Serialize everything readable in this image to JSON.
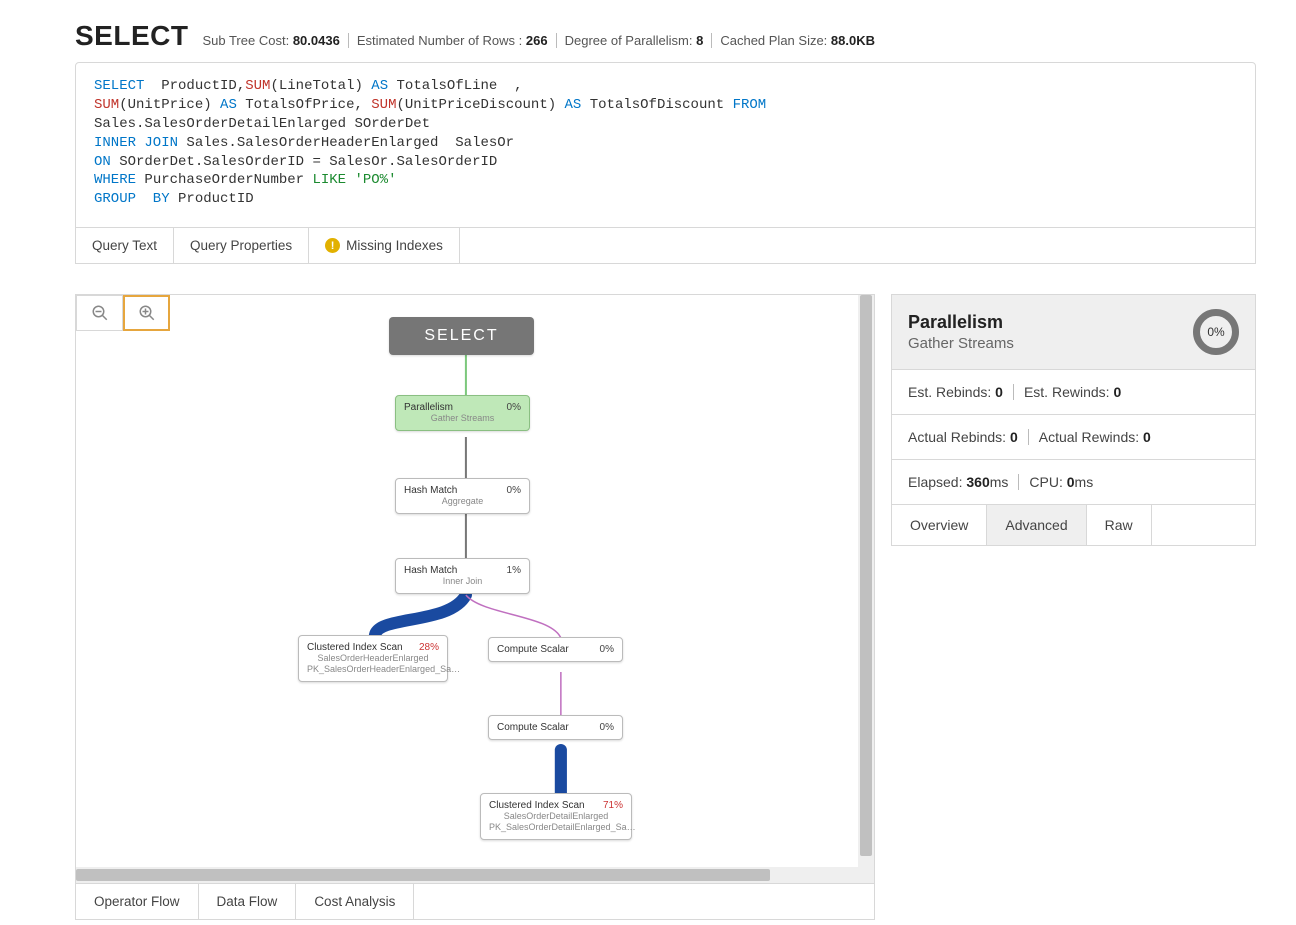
{
  "header": {
    "title": "SELECT",
    "meta": [
      {
        "label": "Sub Tree Cost:",
        "value": "80.0436"
      },
      {
        "label": "Estimated Number of Rows :",
        "value": "266"
      },
      {
        "label": "Degree of Parallelism:",
        "value": "8"
      },
      {
        "label": "Cached Plan Size:",
        "value": "88.0KB"
      }
    ]
  },
  "query_tabs": {
    "text": "Query Text",
    "properties": "Query Properties",
    "missing": "Missing Indexes"
  },
  "sql": {
    "l1": {
      "a": "SELECT",
      "b": "  ProductID,",
      "c": "SUM",
      "d": "(LineTotal) ",
      "e": "AS",
      "f": " TotalsOfLine  ,"
    },
    "l2": {
      "a": "SUM",
      "b": "(UnitPrice) ",
      "c": "AS",
      "d": " TotalsOfPrice, ",
      "e": "SUM",
      "f": "(UnitPriceDiscount) ",
      "g": "AS",
      "h": " TotalsOfDiscount ",
      "i": "FROM"
    },
    "l3": {
      "a": "Sales.SalesOrderDetailEnlarged SOrderDet"
    },
    "l4": {
      "a": "INNER JOIN",
      "b": " Sales.SalesOrderHeaderEnlarged  SalesOr"
    },
    "l5": {
      "a": "ON",
      "b": " SOrderDet.SalesOrderID = SalesOr.SalesOrderID"
    },
    "l6": {
      "a": "WHERE",
      "b": " PurchaseOrderNumber ",
      "c": "LIKE 'PO%'"
    },
    "l7": {
      "a": "GROUP  BY",
      "b": " ProductID"
    }
  },
  "plan": {
    "root": "SELECT",
    "nodes": {
      "parallelism": {
        "title": "Parallelism",
        "sub": "Gather Streams",
        "pct": "0%"
      },
      "hash_agg": {
        "title": "Hash Match",
        "sub": "Aggregate",
        "pct": "0%"
      },
      "hash_join": {
        "title": "Hash Match",
        "sub": "Inner Join",
        "pct": "1%"
      },
      "cis_header": {
        "title": "Clustered Index Scan",
        "sub1": "SalesOrderHeaderEnlarged",
        "sub2": "PK_SalesOrderHeaderEnlarged_Sa…",
        "pct": "28%"
      },
      "compute1": {
        "title": "Compute Scalar",
        "pct": "0%"
      },
      "compute2": {
        "title": "Compute Scalar",
        "pct": "0%"
      },
      "cis_detail": {
        "title": "Clustered Index Scan",
        "sub1": "SalesOrderDetailEnlarged",
        "sub2": "PK_SalesOrderDetailEnlarged_Sa…",
        "pct": "71%"
      }
    }
  },
  "bottom_tabs": {
    "op_flow": "Operator Flow",
    "data_flow": "Data Flow",
    "cost": "Cost Analysis"
  },
  "detail": {
    "title": "Parallelism",
    "subtitle": "Gather Streams",
    "ring": "0%",
    "rows": {
      "estRebindsLabel": "Est. Rebinds:",
      "estRebinds": "0",
      "estRewindsLabel": "Est. Rewinds:",
      "estRewinds": "0",
      "actRebindsLabel": "Actual Rebinds:",
      "actRebinds": "0",
      "actRewindsLabel": "Actual Rewinds:",
      "actRewinds": "0",
      "elapsedLabel": "Elapsed:",
      "elapsedVal": "360",
      "elapsedUnit": "ms",
      "cpuLabel": "CPU:",
      "cpuVal": "0",
      "cpuUnit": "ms"
    },
    "tabs": {
      "overview": "Overview",
      "advanced": "Advanced",
      "raw": "Raw"
    }
  }
}
